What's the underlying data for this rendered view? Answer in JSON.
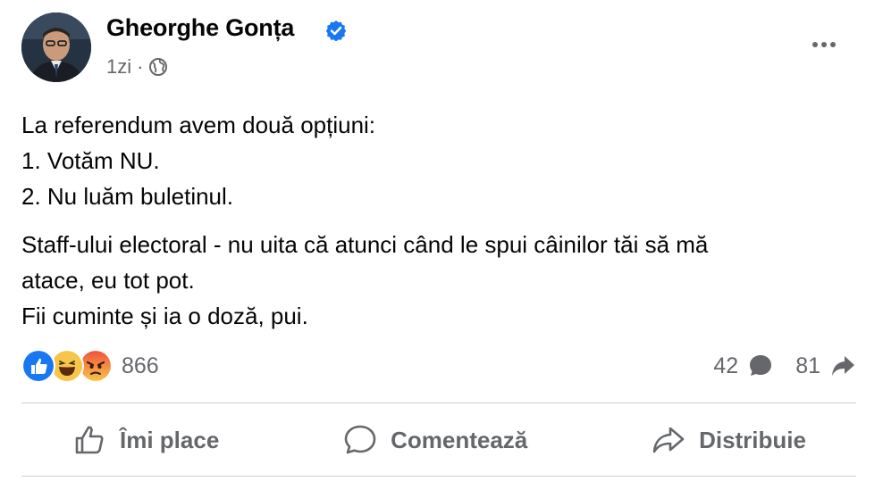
{
  "post": {
    "author_name": "Gheorghe Gonța",
    "timestamp": "1zi",
    "separator": "·",
    "paragraphs": [
      [
        "La referendum avem două opțiuni:",
        "1. Votăm NU.",
        "2. Nu luăm buletinul."
      ],
      [
        "Staff-ului electoral - nu uita că atunci când le spui câinilor tăi să mă",
        "atace, eu tot pot.",
        "Fii cuminte și ia o doză, pui."
      ]
    ]
  },
  "reactions": {
    "icons": [
      "like-icon",
      "haha-icon",
      "angry-icon"
    ],
    "count": "866"
  },
  "stats": {
    "comments": "42",
    "shares": "81"
  },
  "actions": {
    "like": "Îmi place",
    "comment": "Comentează",
    "share": "Distribuie"
  },
  "colors": {
    "like_blue": "#1877f2",
    "emoji_yellow": "#f7c54a",
    "angry_orange": "#f0533c",
    "secondary_text": "#65676b"
  }
}
